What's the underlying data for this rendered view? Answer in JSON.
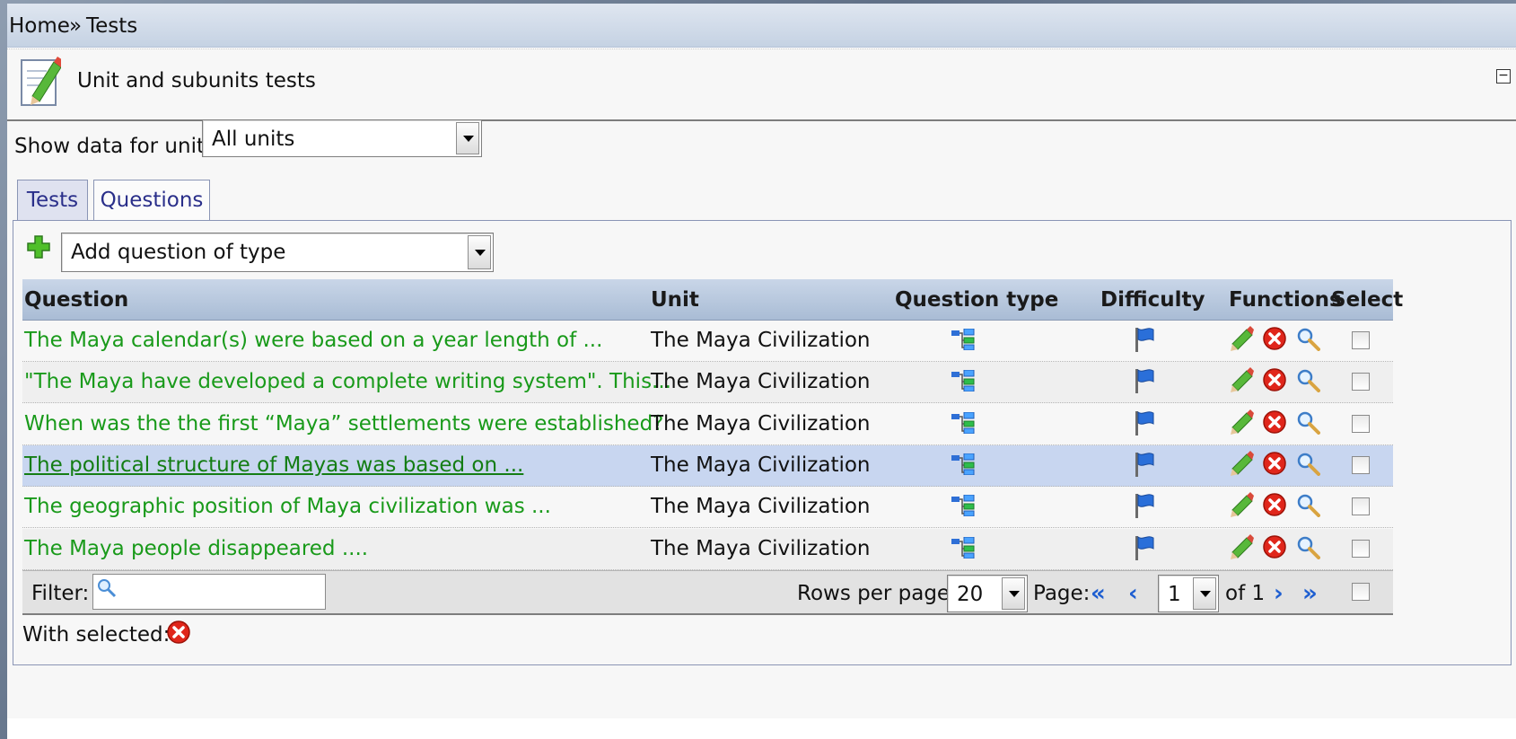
{
  "breadcrumb": {
    "home": "Home",
    "sep": "»",
    "current": "Tests"
  },
  "panel": {
    "title": "Unit and subunits tests",
    "collapse_label": "−"
  },
  "unit_filter": {
    "label": "Show data for unit:",
    "value": "All units"
  },
  "tabs": [
    {
      "label": "Tests"
    },
    {
      "label": "Questions"
    }
  ],
  "add_question": {
    "value": "Add question of type"
  },
  "table": {
    "headers": {
      "question": "Question",
      "unit": "Unit",
      "type": "Question type",
      "difficulty": "Difficulty",
      "functions": "Functions",
      "select": "Select"
    },
    "rows": [
      {
        "question": "The Maya calendar(s) were based on a year length of ...",
        "unit": "The Maya Civilization"
      },
      {
        "question": "\"The Maya have developed a complete writing system\". This...",
        "unit": "The Maya Civilization"
      },
      {
        "question": "When was the the first “Maya” settlements were established?",
        "unit": "The Maya Civilization"
      },
      {
        "question": "The political structure of Mayas was based on ...",
        "unit": "The Maya Civilization"
      },
      {
        "question": "The geographic position of Maya civilization was ...",
        "unit": "The Maya Civilization"
      },
      {
        "question": "The Maya people disappeared ....",
        "unit": "The Maya Civilization"
      }
    ],
    "highlighted_row": 3
  },
  "footer": {
    "filter_label": "Filter:",
    "filter_value": "",
    "rows_per_page_label": "Rows per page:",
    "rows_per_page_value": "20",
    "page_label": "Page:",
    "page_value": "1",
    "of_label": "of 1",
    "first": "«",
    "prev": "‹",
    "next": "›",
    "last": "»"
  },
  "with_selected": {
    "label": "With selected:"
  },
  "icons": {
    "panel": "document-edit-icon",
    "add": "plus-icon",
    "type": "tree-structure-icon",
    "difficulty": "flag-icon",
    "edit": "pencil-icon",
    "delete": "delete-icon",
    "preview": "magnifier-icon",
    "search": "search-icon"
  },
  "colors": {
    "link": "#199a1a",
    "header_bg": "#b8c8de",
    "highlight": "#c8d6f0",
    "nav": "#1f5fd1"
  }
}
